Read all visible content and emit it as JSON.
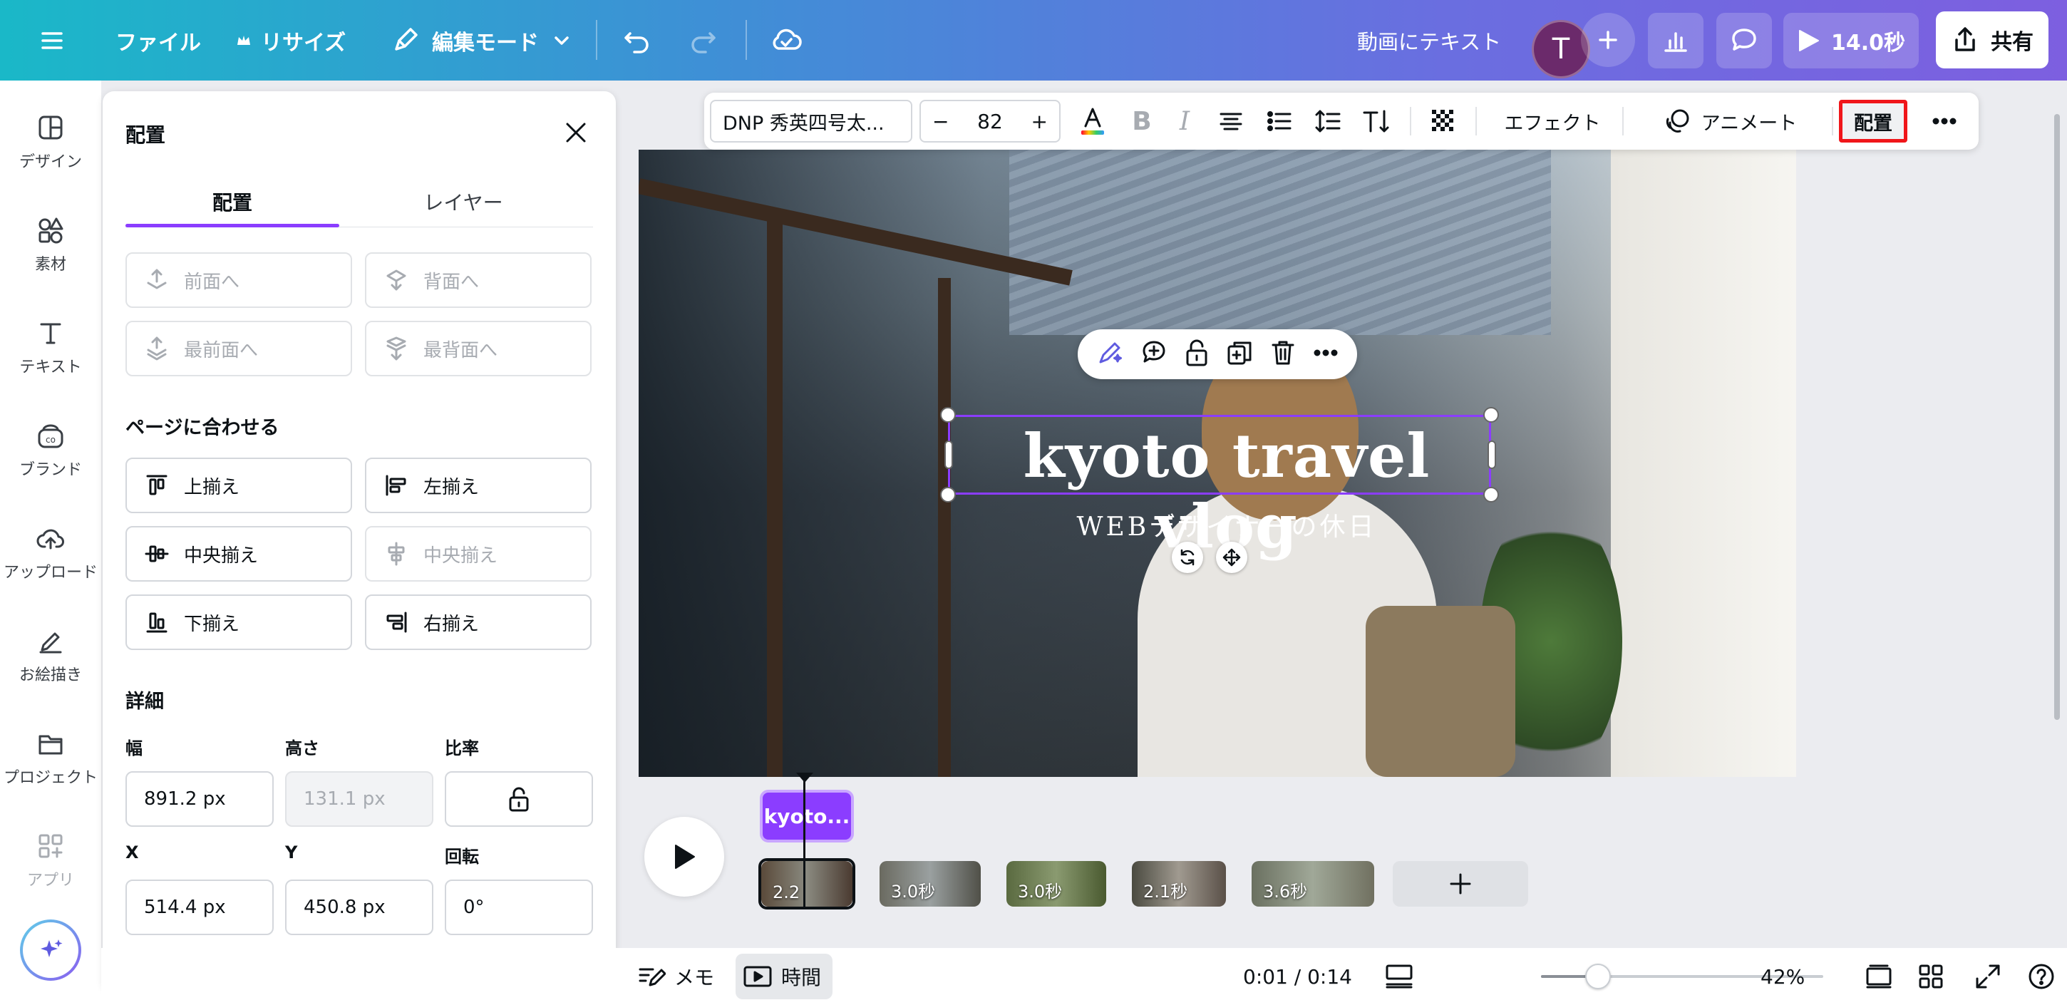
{
  "topbar": {
    "file": "ファイル",
    "resize": "リサイズ",
    "edit_mode": "編集モード",
    "doc_title": "動画にテキスト",
    "avatar_initial": "T",
    "play_duration": "14.0秒",
    "share": "共有"
  },
  "rail": {
    "items": [
      {
        "label": "デザイン",
        "icon": "design-icon"
      },
      {
        "label": "素材",
        "icon": "elements-icon"
      },
      {
        "label": "テキスト",
        "icon": "text-icon"
      },
      {
        "label": "ブランド",
        "icon": "brand-icon"
      },
      {
        "label": "アップロード",
        "icon": "upload-icon"
      },
      {
        "label": "お絵描き",
        "icon": "draw-icon"
      },
      {
        "label": "プロジェクト",
        "icon": "projects-icon"
      },
      {
        "label": "アプリ",
        "icon": "apps-icon"
      }
    ]
  },
  "panel": {
    "title": "配置",
    "tabs": [
      "配置",
      "レイヤー"
    ],
    "layer_buttons": [
      "前面へ",
      "背面へ",
      "最前面へ",
      "最背面へ"
    ],
    "fit_heading": "ページに合わせる",
    "align_buttons": [
      "上揃え",
      "左揃え",
      "中央揃え",
      "中央揃え",
      "下揃え",
      "右揃え"
    ],
    "detail_heading": "詳細",
    "labels": {
      "width": "幅",
      "height": "高さ",
      "ratio": "比率",
      "x": "X",
      "y": "Y",
      "rotation": "回転"
    },
    "values": {
      "width": "891.2 px",
      "height": "131.1 px",
      "x": "514.4 px",
      "y": "450.8 px",
      "rotation": "0°"
    }
  },
  "text_toolbar": {
    "font": "DNP 秀英四号太...",
    "size": "82",
    "minus": "−",
    "plus": "+",
    "bold": "B",
    "italic": "I",
    "effect": "エフェクト",
    "animate": "アニメート",
    "position": "配置"
  },
  "canvas": {
    "headline": "kyoto travel vlog",
    "subtitle": "WEBデザイナーの休日"
  },
  "timeline": {
    "text_track": "kyoto...",
    "clips": [
      "2.2",
      "3.0秒",
      "3.0秒",
      "2.1秒",
      "3.6秒"
    ]
  },
  "bottombar": {
    "memo": "メモ",
    "time": "時間",
    "timecode": "0:01 / 0:14",
    "zoom": "42%",
    "zoom_fraction": 0.42
  },
  "colors": {
    "accent": "#8b3dff",
    "highlight": "#f0161a"
  }
}
